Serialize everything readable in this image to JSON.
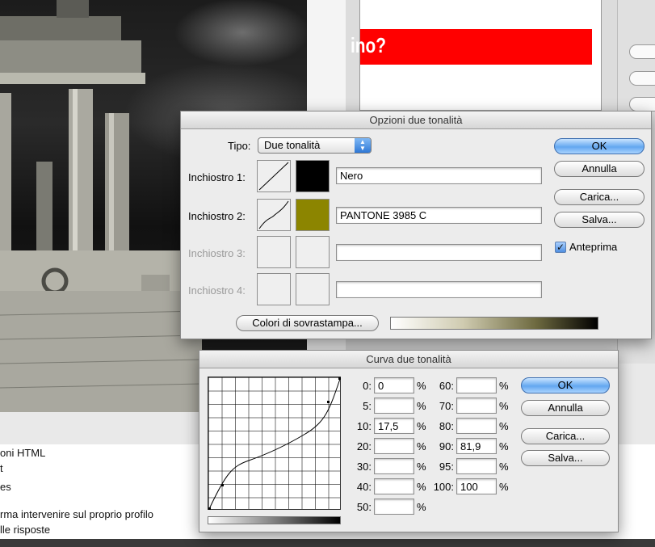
{
  "background": {
    "webpage_banner_text": "ino?",
    "bottom_text_lines": [
      "oni HTML",
      "t",
      "es",
      "rma intervenire sul proprio profilo",
      "lle risposte"
    ]
  },
  "duotone_options": {
    "title": "Opzioni due tonalità",
    "type_label": "Tipo:",
    "type_value": "Due tonalità",
    "inks": [
      {
        "label": "Inchiostro 1:",
        "name": "Nero",
        "color": "#000000",
        "enabled": true
      },
      {
        "label": "Inchiostro 2:",
        "name": "PANTONE 3985 C",
        "color": "#8c8500",
        "enabled": true
      },
      {
        "label": "Inchiostro 3:",
        "name": "",
        "color": "",
        "enabled": false
      },
      {
        "label": "Inchiostro 4:",
        "name": "",
        "color": "",
        "enabled": false
      }
    ],
    "overprint_button": "Colori di sovrastampa...",
    "buttons": {
      "ok": "OK",
      "cancel": "Annulla",
      "load": "Carica...",
      "save": "Salva..."
    },
    "preview_label": "Anteprima",
    "preview_checked": true
  },
  "duotone_curve": {
    "title": "Curva due tonalità",
    "left_labels": [
      "0:",
      "5:",
      "10:",
      "20:",
      "30:",
      "40:",
      "50:"
    ],
    "left_values": [
      "0",
      "",
      "17,5",
      "",
      "",
      "",
      ""
    ],
    "right_labels": [
      "60:",
      "70:",
      "80:",
      "90:",
      "95:",
      "100:"
    ],
    "right_values": [
      "",
      "",
      "",
      "81,9",
      "",
      "100"
    ],
    "percent_sign": "%",
    "buttons": {
      "ok": "OK",
      "cancel": "Annulla",
      "load": "Carica...",
      "save": "Salva..."
    }
  }
}
